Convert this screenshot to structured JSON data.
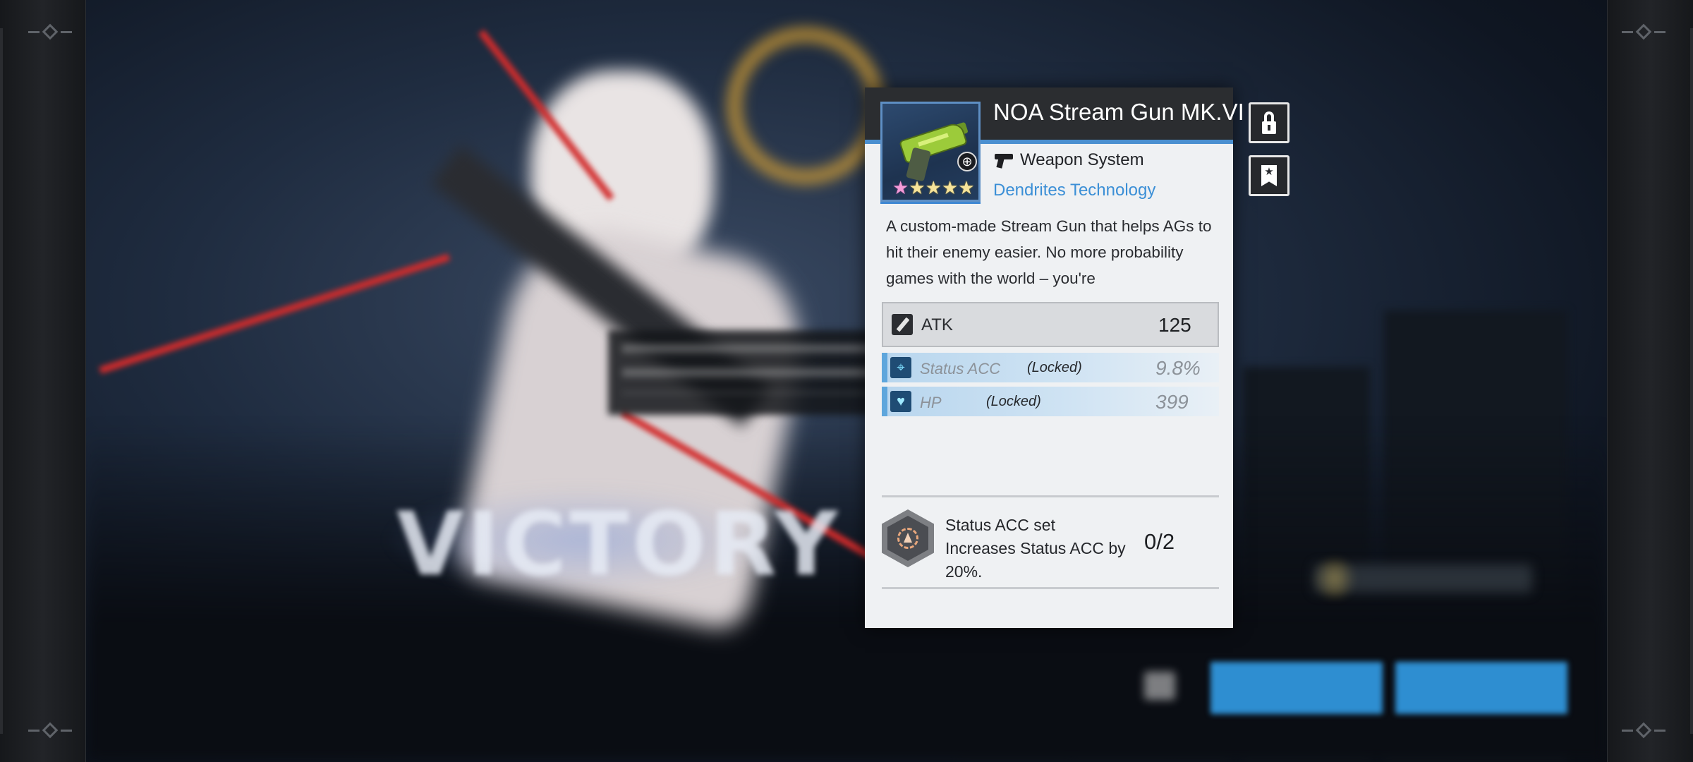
{
  "item": {
    "name": "NOA Stream Gun MK.VI",
    "type": "Weapon System",
    "manufacturer": "Dendrites Technology",
    "rarity_stars": 5,
    "description": "A custom-made Stream Gun that helps AGs to hit their enemy easier. No more probability games with the world – you're",
    "main_stat": {
      "name": "ATK",
      "value": "125"
    },
    "sub_stats": [
      {
        "name": "Status ACC",
        "lock": "(Locked)",
        "value": "9.8%"
      },
      {
        "name": "HP",
        "lock": "(Locked)",
        "value": "399"
      }
    ],
    "set_bonus": {
      "title": "Status ACC set",
      "effect": "Increases Status ACC by 20%.",
      "count": "0/2"
    }
  },
  "background": {
    "banner_text": "VICTORY"
  },
  "colors": {
    "accent_blue": "#3b8fd6",
    "header_dark": "#2b2d30",
    "card_bg": "#eff1f3",
    "gun_green": "#9ccb3a",
    "button_blue": "#2e8ed1"
  },
  "icons": {
    "weapon_type": "pistol-icon",
    "main_stat": "pen-icon",
    "sub_stat_1": "crosshair-icon",
    "sub_stat_2": "heart-icon",
    "set": "hexagon-set-icon",
    "lock_action": "padlock-icon",
    "favorite_action": "bookmark-star-icon"
  }
}
